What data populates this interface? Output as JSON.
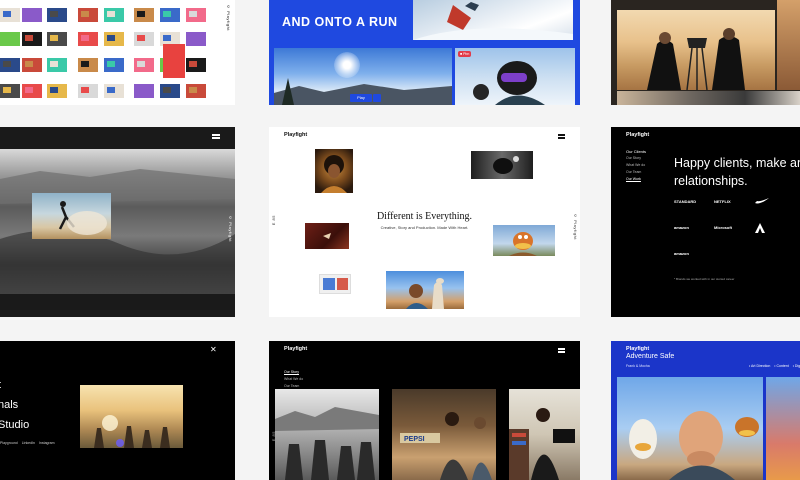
{
  "run_tile": {
    "heading": "AND ONTO A RUN",
    "play_label": "Play",
    "badge": "■ Pbn"
  },
  "center_tile": {
    "brand": "Playfight",
    "headline": "Different is Everything.",
    "subline": "Creative, Story and Production. Made With Heart.",
    "side_left": "E 85",
    "side_right": "© Playfight"
  },
  "clients_tile": {
    "brand": "Playfight",
    "section_label": "Our Clients",
    "nav": [
      "Our Story",
      "What We do",
      "Our Team",
      "Our Work"
    ],
    "headline_line1": "Happy clients, make an",
    "headline_line2": "relationships.",
    "logos": [
      "STANDARD",
      "NETFLIX",
      "nike-swoosh",
      "",
      "amazon",
      "Microsoft",
      "adobe-logo",
      "",
      "amazon",
      "",
      "",
      ""
    ],
    "footnote": "* Brands we worked with in our storied career"
  },
  "studio_tile": {
    "lines": [
      "t",
      "nals",
      "Studio"
    ],
    "links": [
      "Playground",
      "LinkedIn",
      "Instagram"
    ],
    "close_icon": "close-icon"
  },
  "work_tile": {
    "brand": "Playfight",
    "nav": [
      "Our Story",
      "What We do",
      "Our Team"
    ],
    "side": "E 85"
  },
  "adventure_tile": {
    "brand": "Playfight",
    "title": "Adventure Safe",
    "subtitle": "Frank & Mocha",
    "links": [
      "Art Direction",
      "Content",
      "Dig"
    ]
  },
  "gray_tile": {
    "side": "© Playfight"
  },
  "left_top_tile": {
    "side": "© Playfight"
  },
  "colors": {
    "blue": "#1f49e0",
    "navy": "#1b35c9",
    "black": "#000000",
    "white": "#ffffff"
  }
}
